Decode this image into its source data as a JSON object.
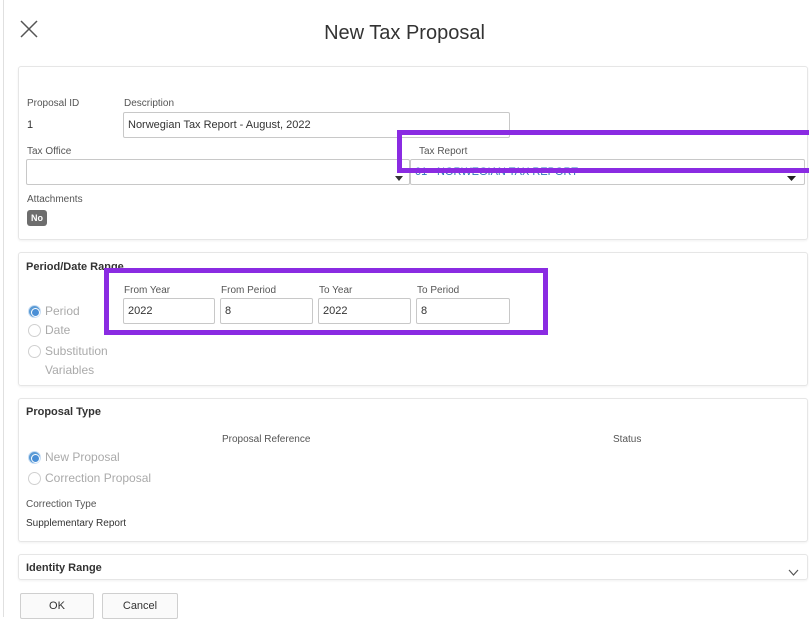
{
  "dialog": {
    "title": "New Tax Proposal"
  },
  "general": {
    "proposal_id_label": "Proposal ID",
    "proposal_id_value": "1",
    "description_label": "Description",
    "description_value": "Norwegian Tax Report - August, 2022",
    "tax_office_label": "Tax Office",
    "tax_office_value": "",
    "tax_report_label": "Tax Report",
    "tax_report_value": "01 - NORWEGIAN TAX REPORT",
    "attachments_label": "Attachments",
    "attachments_value": "No"
  },
  "period": {
    "section_label": "Period/Date Range",
    "options": [
      "Period",
      "Date",
      "Substitution",
      "Variables"
    ],
    "from_year_label": "From Year",
    "from_year_value": "2022",
    "from_period_label": "From Period",
    "from_period_value": "8",
    "to_year_label": "To Year",
    "to_year_value": "2022",
    "to_period_label": "To Period",
    "to_period_value": "8"
  },
  "proposal_type": {
    "section_label": "Proposal Type",
    "reference_label": "Proposal Reference",
    "status_label": "Status",
    "options": [
      "New Proposal",
      "Correction Proposal"
    ],
    "correction_type_label": "Correction Type",
    "correction_type_value": "Supplementary Report"
  },
  "identity": {
    "section_label": "Identity Range"
  },
  "footer": {
    "ok_label": "OK",
    "cancel_label": "Cancel"
  },
  "colors": {
    "highlight": "#8a2be2",
    "accent": "#2e75b6",
    "badge": "#6d6d6d"
  }
}
